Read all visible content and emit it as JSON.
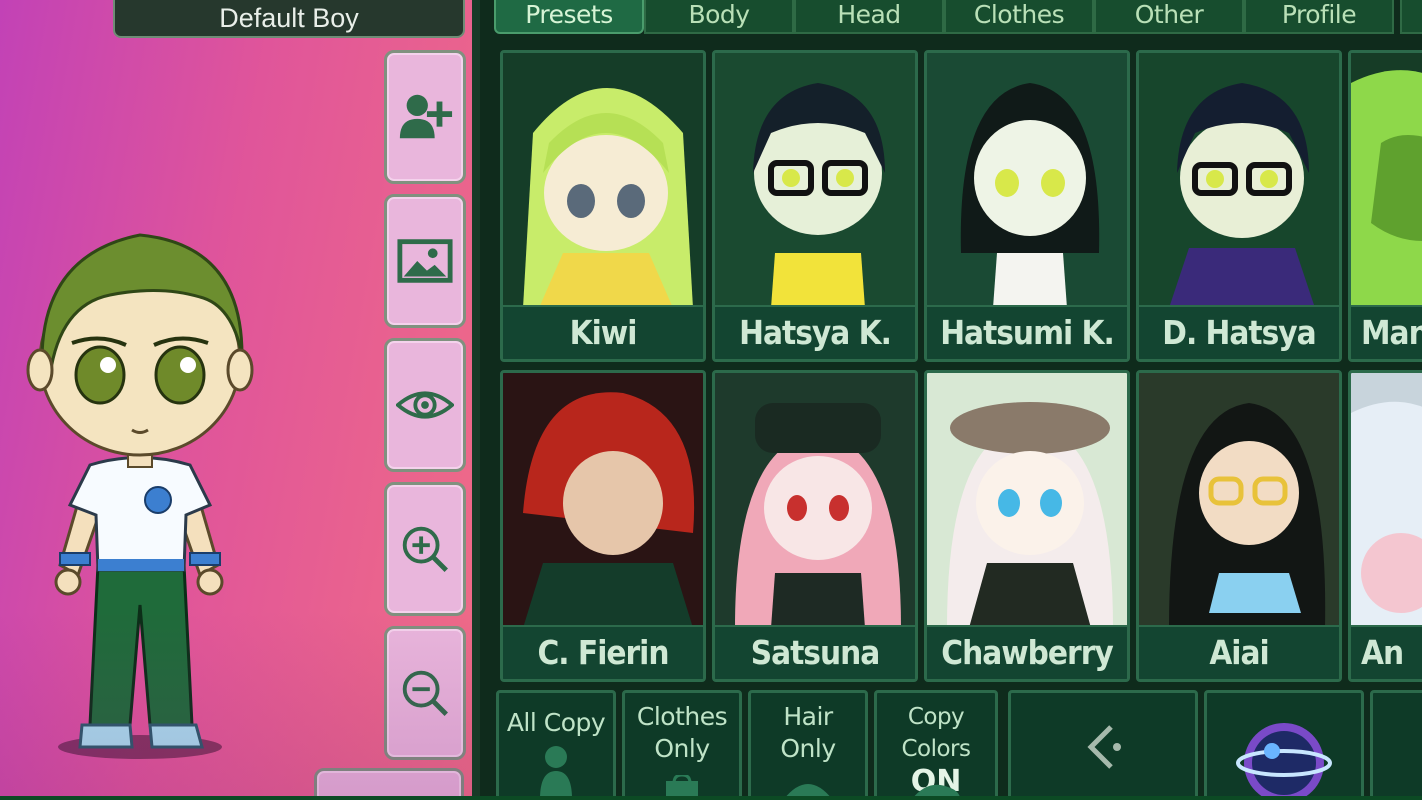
{
  "character": {
    "name": "Default Boy"
  },
  "side_buttons": [
    {
      "icon": "add-user-icon"
    },
    {
      "icon": "image-icon"
    },
    {
      "icon": "eye-icon"
    },
    {
      "icon": "zoom-in-icon"
    },
    {
      "icon": "zoom-out-icon"
    }
  ],
  "tabs": [
    {
      "label": "Presets",
      "active": true
    },
    {
      "label": "Body"
    },
    {
      "label": "Head"
    },
    {
      "label": "Clothes"
    },
    {
      "label": "Other"
    },
    {
      "label": "Profile"
    }
  ],
  "presets": [
    {
      "name": "Kiwi"
    },
    {
      "name": "Hatsya K."
    },
    {
      "name": "Hatsumi K."
    },
    {
      "name": "D. Hatsya"
    },
    {
      "name": "Man"
    },
    {
      "name": "C. Fierin"
    },
    {
      "name": "Satsuna"
    },
    {
      "name": "Chawberry"
    },
    {
      "name": "Aiai"
    },
    {
      "name": "An"
    }
  ],
  "bottom": {
    "all_copy": "All Copy",
    "clothes_only_1": "Clothes",
    "clothes_only_2": "Only",
    "hair_only_1": "Hair",
    "hair_only_2": "Only",
    "copy_colors": "Copy Colors",
    "copy_colors_state": "ON"
  },
  "colors": {
    "stage_start": "#c242b6",
    "stage_end": "#f06c86",
    "panel_bg": "#0f2b1c",
    "accent": "#2c6a4b"
  }
}
